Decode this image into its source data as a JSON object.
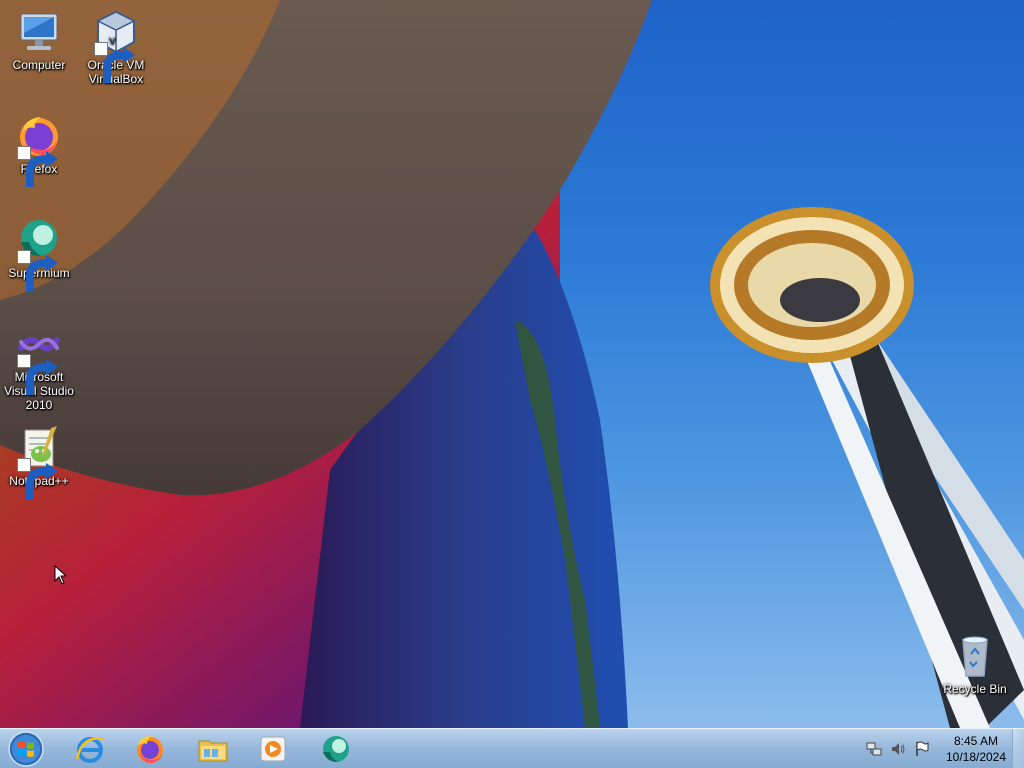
{
  "desktop": {
    "icons": [
      {
        "label": "Computer",
        "icon": "computer-icon"
      },
      {
        "label": "Oracle VM\nVirtualBox",
        "icon": "virtualbox-icon"
      },
      {
        "label": "Firefox",
        "icon": "firefox-icon"
      },
      {
        "label": "Supermium",
        "icon": "supermium-icon"
      },
      {
        "label": "Microsoft\nVisual Studio\n2010",
        "icon": "visual-studio-icon"
      },
      {
        "label": "Notepad++",
        "icon": "notepadpp-icon"
      },
      {
        "label": "Recycle Bin",
        "icon": "recycle-bin-icon"
      }
    ]
  },
  "taskbar": {
    "start": {
      "icon": "windows-start-icon"
    },
    "pinned": [
      {
        "name": "Internet Explorer",
        "icon": "internet-explorer-icon"
      },
      {
        "name": "Firefox",
        "icon": "firefox-icon"
      },
      {
        "name": "Windows Explorer",
        "icon": "folder-icon"
      },
      {
        "name": "Windows Media Player",
        "icon": "media-player-icon"
      },
      {
        "name": "Supermium",
        "icon": "supermium-icon"
      }
    ],
    "tray": {
      "icons": [
        "network-icon",
        "volume-icon",
        "action-center-flag-icon"
      ],
      "time": "8:45 AM",
      "date": "10/18/2024"
    }
  },
  "colors": {
    "sky": "#2c7ad6",
    "taskbar": "#a8c4e0",
    "icon_text": "#ffffff"
  }
}
